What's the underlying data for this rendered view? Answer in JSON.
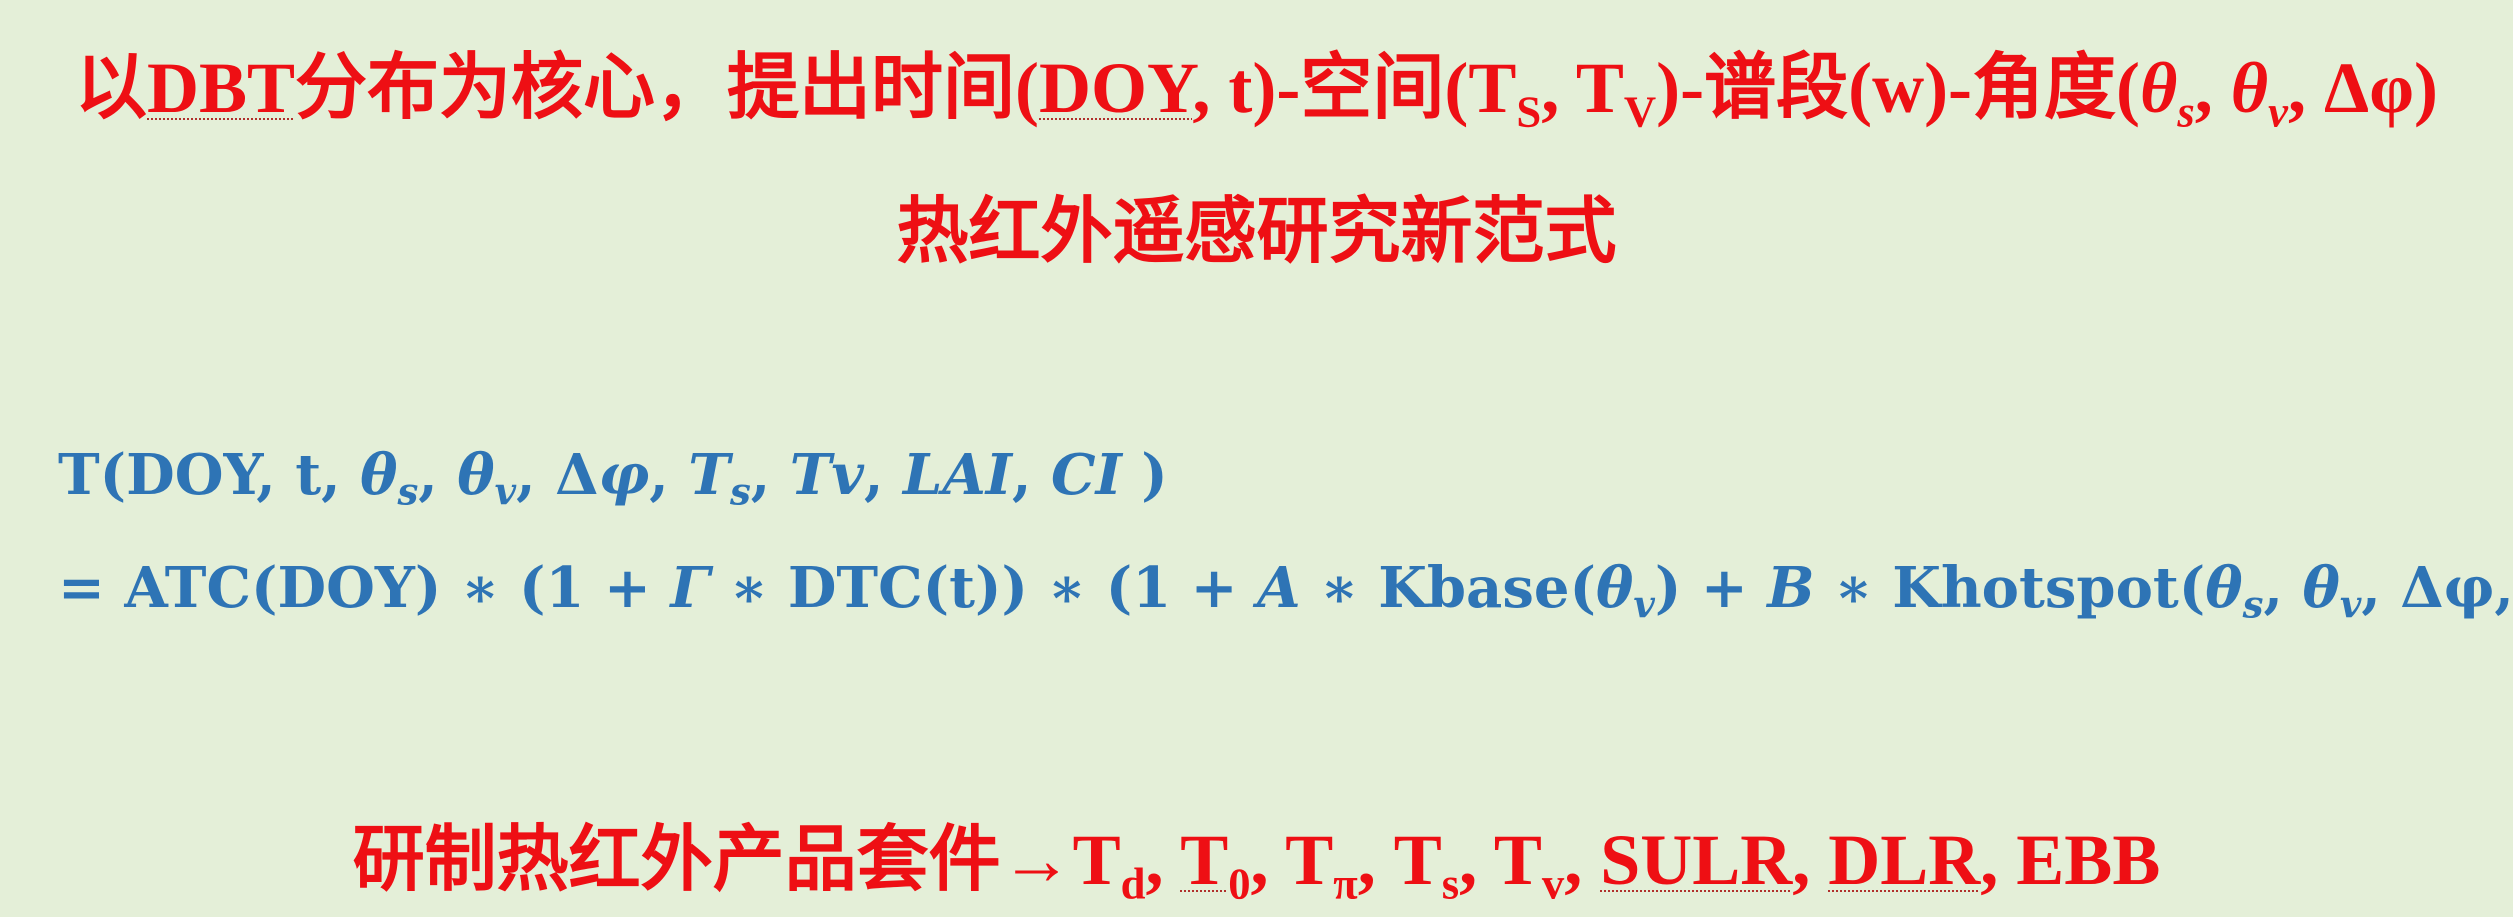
{
  "title": {
    "p1": "以",
    "p2": "DBT",
    "p3": "分布为核心，提出时间(",
    "p4": "DOY",
    "p5": ", t)-空间(T",
    "p6": "S",
    "p7": ", T",
    "p8": "V",
    "p9": ")-谱段(w)-角度(",
    "p10": "θ",
    "p11": "s",
    "p12": ", ",
    "p13": "θ",
    "p14": "v",
    "p15": ", Δφ)"
  },
  "subtitle": "热红外遥感研究新范式",
  "equation": {
    "line1": {
      "a": "T(DOY, t, ",
      "b": "θ",
      "c": "s",
      "d": ", ",
      "e": "θ",
      "f": "v",
      "g": ", Δ",
      "h": "φ",
      "i": ", ",
      "j": "T",
      "k": "s",
      "l": ", ",
      "m": "Tv",
      "n": ", ",
      "o": "LAI",
      "p": ", ",
      "q": "CI",
      "r": " )"
    },
    "line2": {
      "a": "= ATC(DOY) ∗ (1 + ",
      "b": "Γ",
      "c": " ∗ DTC(t)) ∗ (1 + ",
      "d": "A",
      "e": " ∗ Kbase(",
      "f": "θ",
      "g": "v",
      "h": ") + ",
      "i": "B",
      "j": " ∗ Khotspot(",
      "k": "θ",
      "l": "s",
      "m": ", ",
      "n": "θ",
      "o": "v",
      "p": ", Δφ, w))"
    }
  },
  "products": {
    "a": "研制热红外产品套件→T",
    "b": "d",
    "c": ", ",
    "d": "T",
    "e": "0",
    "f": ", T",
    "g": "π",
    "h": ", T",
    "i": "s",
    "j": ", T",
    "k": "v",
    "l": ", ",
    "m": "SULR",
    "n": ", ",
    "o": "DLR",
    "p": ", EBB"
  },
  "colors": {
    "red_text": "#ee0f14",
    "blue_text": "#2e74b5",
    "background": "#e4efd8"
  }
}
